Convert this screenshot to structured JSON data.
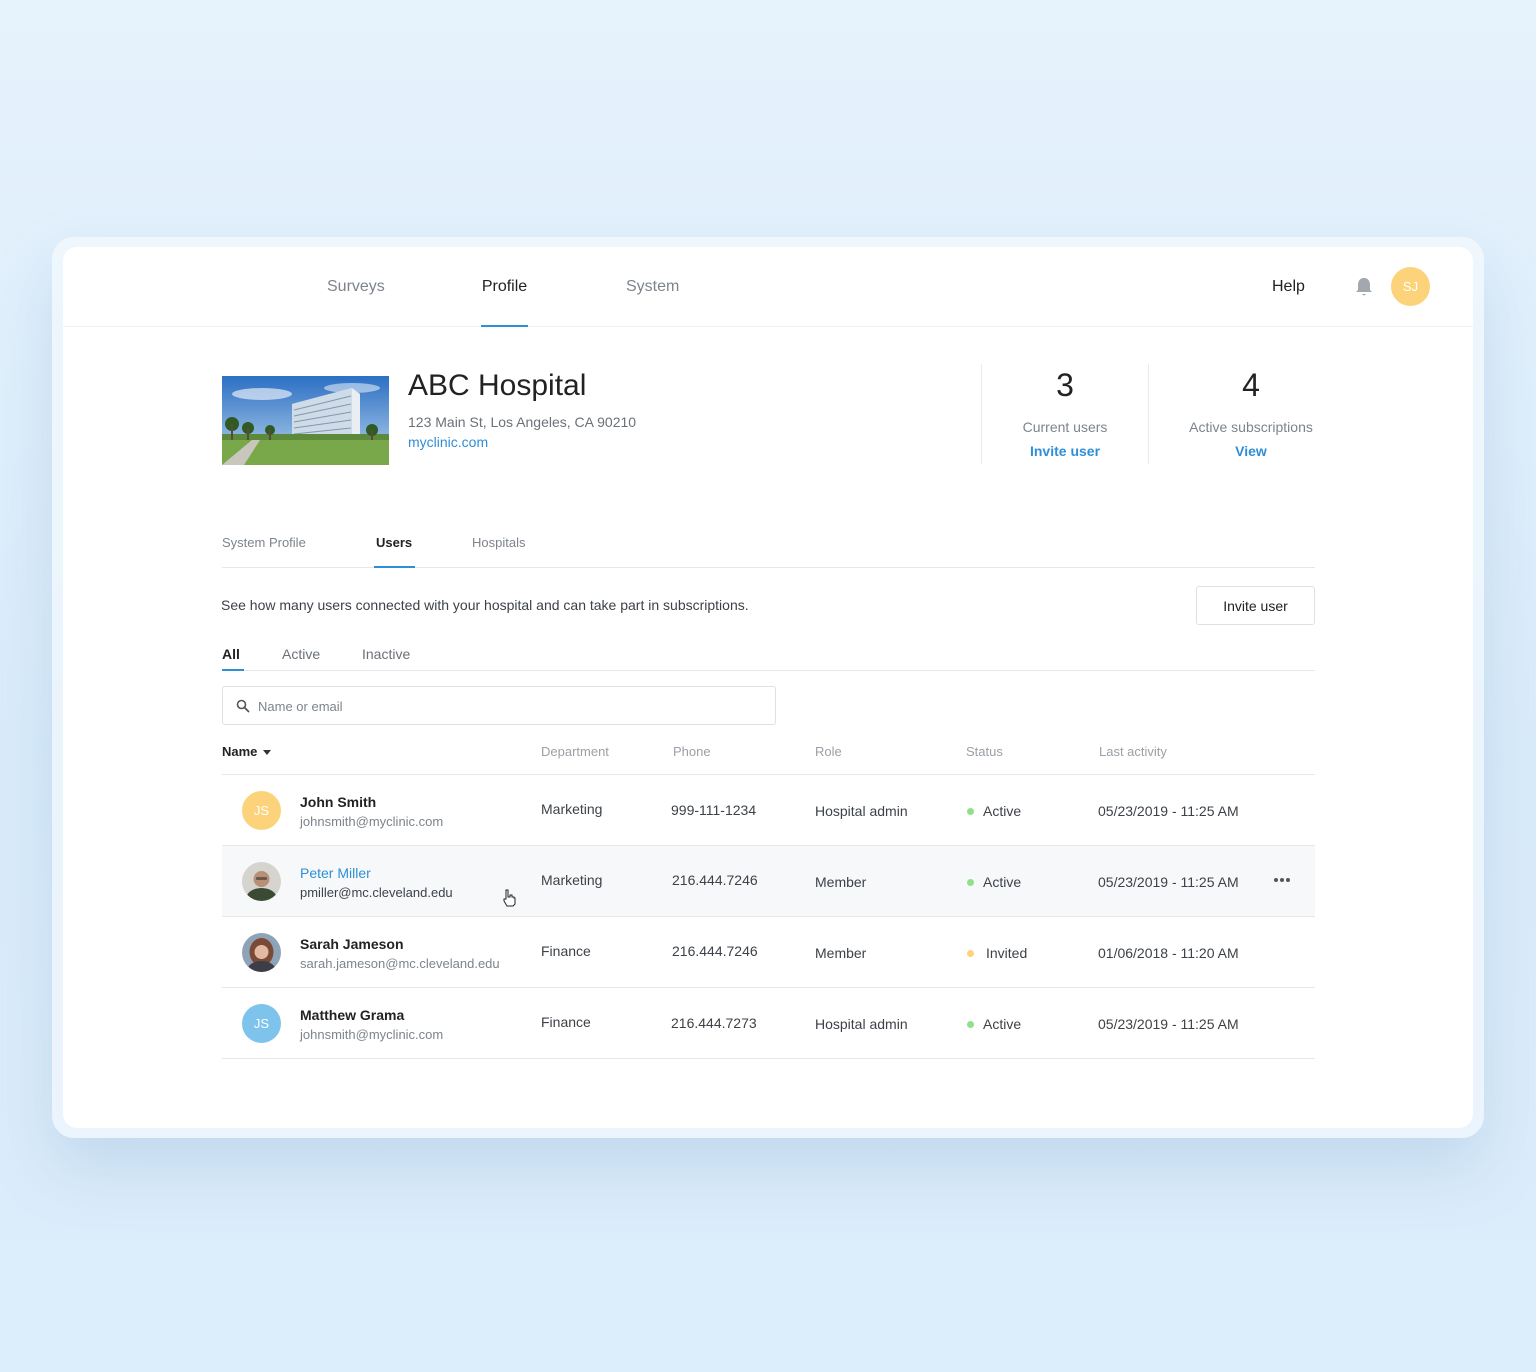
{
  "nav": {
    "tabs": [
      {
        "label": "Surveys"
      },
      {
        "label": "Profile"
      },
      {
        "label": "System"
      }
    ],
    "help": "Help",
    "bell_icon": "bell-icon",
    "user_initials": "SJ"
  },
  "hospital": {
    "name": "ABC Hospital",
    "address": "123 Main St, Los Angeles, CA 90210",
    "website": "myclinic.com",
    "stats": [
      {
        "value": "3",
        "label": "Current users",
        "link": "Invite user"
      },
      {
        "value": "4",
        "label": "Active subscriptions",
        "link": "View"
      }
    ]
  },
  "subtabs": [
    "System Profile",
    "Users",
    "Hospitals"
  ],
  "users_section": {
    "description": "See how many users connected with your hospital and can take part in subscriptions.",
    "invite_button": "Invite user",
    "filters": [
      "All",
      "Active",
      "Inactive"
    ],
    "search_placeholder": "Name or email",
    "columns": [
      "Name",
      "Department",
      "Phone",
      "Role",
      "Status",
      "Last activity"
    ],
    "rows": [
      {
        "initials": "JS",
        "name": "John Smith",
        "email": "johnsmith@myclinic.com",
        "department": "Marketing",
        "phone": "999-111-1234",
        "role": "Hospital admin",
        "status": "Active",
        "last_activity": "05/23/2019 - 11:25 AM"
      },
      {
        "initials": "",
        "name": "Peter Miller",
        "email": "pmiller@mc.cleveland.edu",
        "department": "Marketing",
        "phone": "216.444.7246",
        "role": "Member",
        "status": "Active",
        "last_activity": "05/23/2019 - 11:25 AM"
      },
      {
        "initials": "",
        "name": "Sarah Jameson",
        "email": "sarah.jameson@mc.cleveland.edu",
        "department": "Finance",
        "phone": "216.444.7246",
        "role": "Member",
        "status": "Invited",
        "last_activity": "01/06/2018 - 11:20 AM"
      },
      {
        "initials": "JS",
        "name": "Matthew Grama",
        "email": "johnsmith@myclinic.com",
        "department": "Finance",
        "phone": "216.444.7273",
        "role": "Hospital admin",
        "status": "Active",
        "last_activity": "05/23/2019 - 11:25 AM"
      }
    ]
  },
  "colors": {
    "accent": "#2f8fd6",
    "status_active": "#8fe08a",
    "status_invited": "#fcd37a",
    "avatar_yellow": "#fcd37a",
    "avatar_blue": "#7dc3ec"
  }
}
